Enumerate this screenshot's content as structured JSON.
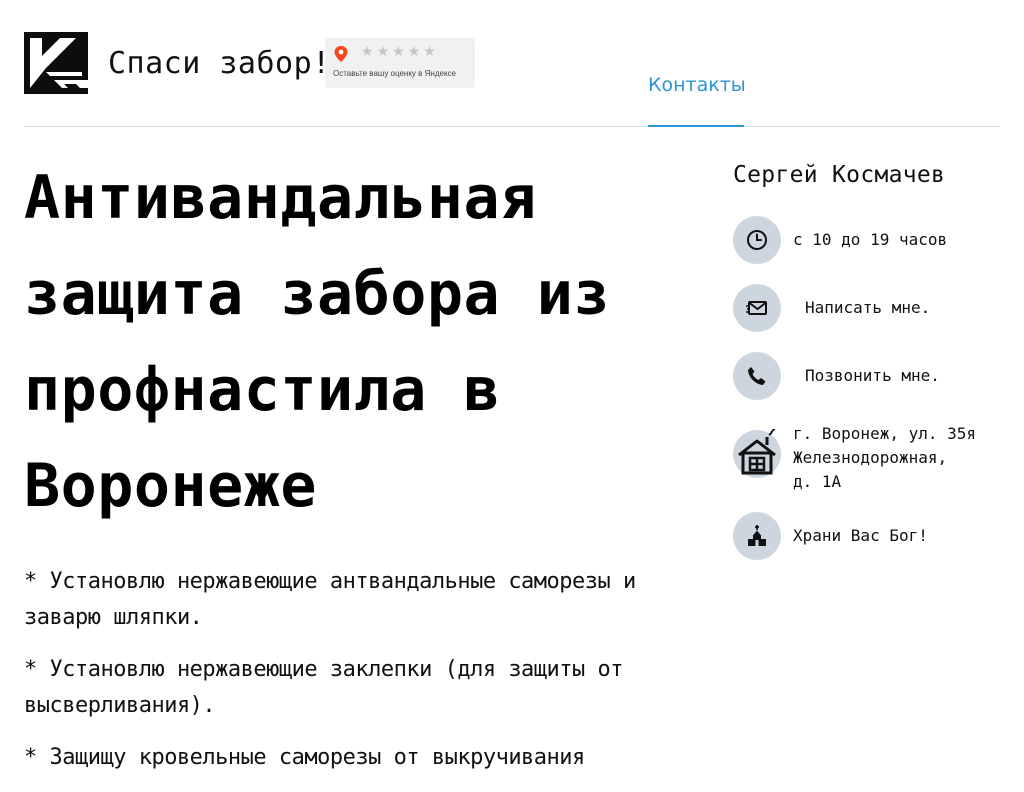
{
  "header": {
    "site_title": "Спаси забор!",
    "rating_caption": "Оставьте вашу оценку в Яндексе",
    "rating_stars": 0,
    "nav_contacts": "Контакты",
    "accent_color": "#2c93d6"
  },
  "main": {
    "headline_lines": [
      "Антивандальная",
      "защита забора из",
      "профнастила в",
      "Воронеже"
    ],
    "paragraphs": [
      "* Установлю нержавеющие антвандальные саморезы и заварю шляпки.",
      "* Установлю нержавеющие заклепки (для защиты от высверливания).",
      "* Защищу кровельные саморезы от выкручивания"
    ]
  },
  "sidebar": {
    "name": "Сергей Космачев",
    "hours": "с 10 до 19 часов",
    "write": "Написать мне.",
    "call": "Позвонить мне.",
    "address_lines": [
      "г. Воронеж, ул. 35я",
      "Железнодорожная,",
      "д. 1А"
    ],
    "blessing": "Храни Вас Бог!"
  },
  "icons": {
    "logo": "logo-icon",
    "map_pin": "map-pin-icon",
    "clock": "clock-icon",
    "mail": "mail-icon",
    "phone": "phone-icon",
    "house": "house-icon",
    "church": "church-icon"
  }
}
